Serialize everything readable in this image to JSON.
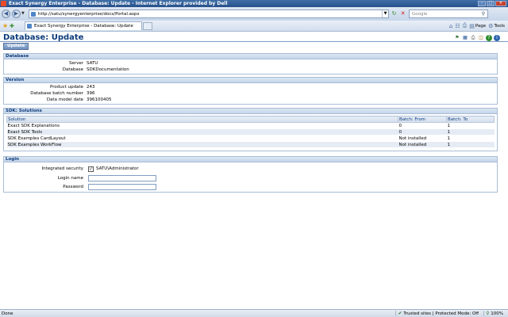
{
  "window": {
    "title": "Exact Synergy Enterprise - Database: Update - Internet Explorer provided by Dell",
    "controls": [
      "minimize",
      "maximize",
      "close"
    ]
  },
  "browser": {
    "url": "http://satu/synergyenterprise/docs/Portal.aspx",
    "search_placeholder": "Google",
    "tab_label": "Exact Synergy Enterprise - Database: Update",
    "commands": {
      "page": "Page",
      "tools": "Tools"
    }
  },
  "page": {
    "title": "Database: Update",
    "update_button": "Update",
    "database_section": {
      "heading": "Database",
      "server_label": "Server",
      "server_value": "SATU",
      "database_label": "Database",
      "database_value": "SDKDocumentation"
    },
    "version_section": {
      "heading": "Version",
      "product_update_label": "Product update",
      "product_update_value": "243",
      "batch_label": "Database batch number",
      "batch_value": "396",
      "model_date_label": "Data model date",
      "model_date_value": "396100405"
    },
    "solutions_section": {
      "heading": "SDK: Solutions",
      "columns": [
        "Solution",
        "Batch: From",
        "Batch: To"
      ],
      "rows": [
        [
          "Exact SDK Explanations",
          "0",
          "1"
        ],
        [
          "Exact SDK Tools",
          "0",
          "1"
        ],
        [
          "SDK Examples CardLayout",
          "Not installed",
          "1"
        ],
        [
          "SDK Examples WorkFlow",
          "Not installed",
          "1"
        ]
      ]
    },
    "login_section": {
      "heading": "Login",
      "integrated_label": "Integrated security",
      "integrated_checked": true,
      "integrated_value": "SATU\\Administrator",
      "login_name_label": "Login name",
      "login_name_value": "",
      "password_label": "Password",
      "password_value": ""
    }
  },
  "statusbar": {
    "left": "Done",
    "zone": "Trusted sites | Protected Mode: Off",
    "zoom": "100%"
  }
}
